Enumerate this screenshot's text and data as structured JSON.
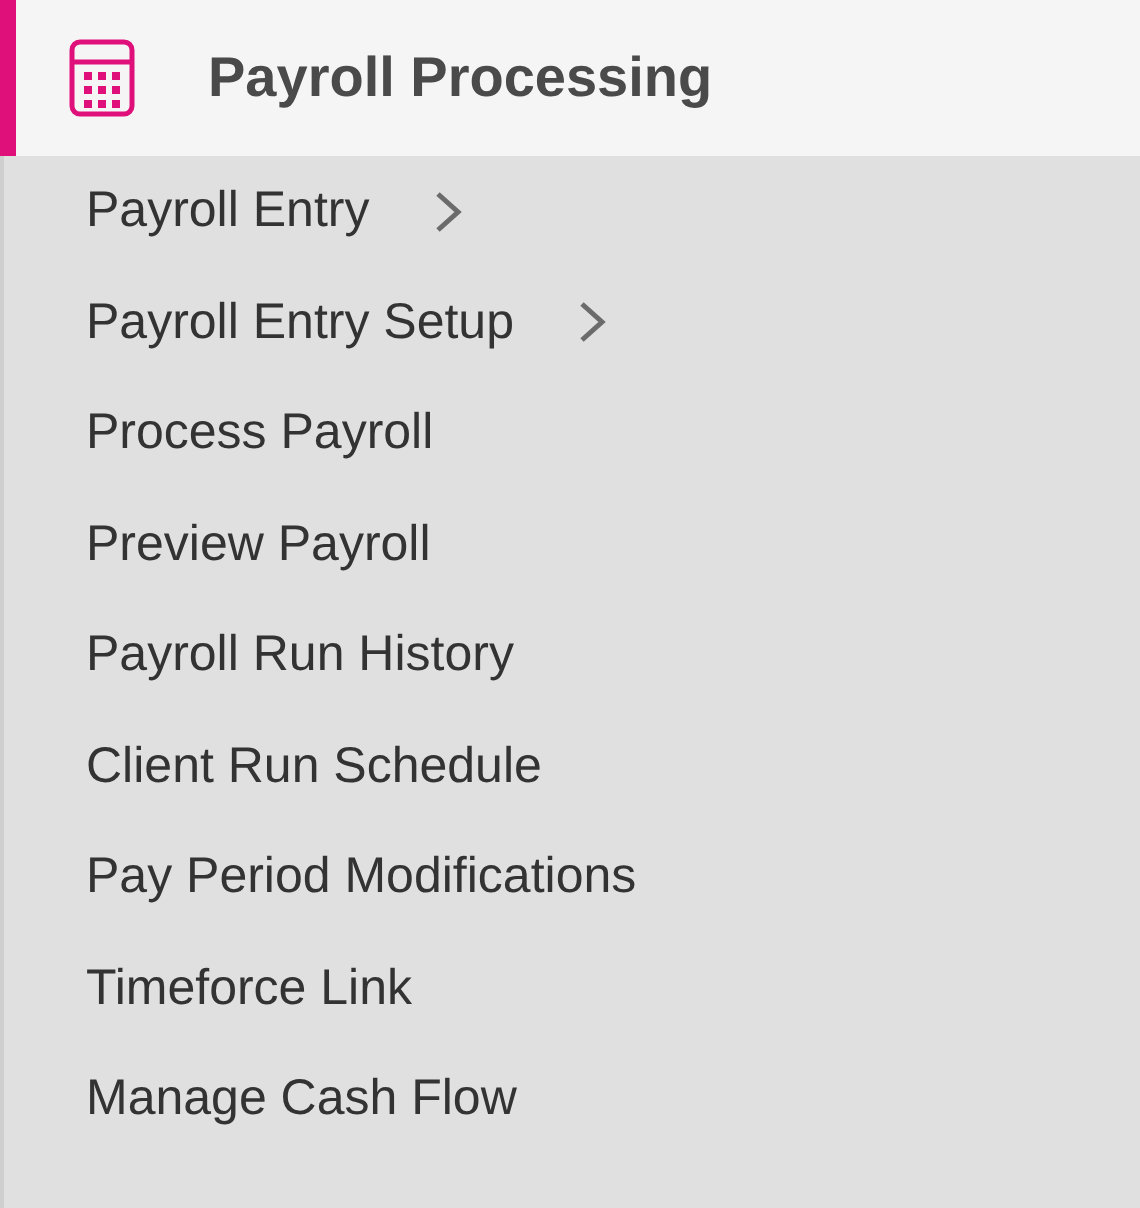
{
  "header": {
    "title": "Payroll Processing",
    "selected": true
  },
  "items": [
    {
      "label": "Payroll Entry",
      "has_submenu": true
    },
    {
      "label": "Payroll Entry Setup",
      "has_submenu": true
    },
    {
      "label": "Process Payroll",
      "has_submenu": false
    },
    {
      "label": "Preview Payroll",
      "has_submenu": false
    },
    {
      "label": "Payroll Run History",
      "has_submenu": false
    },
    {
      "label": "Client Run Schedule",
      "has_submenu": false
    },
    {
      "label": "Pay Period Modifications",
      "has_submenu": false
    },
    {
      "label": "Timeforce Link",
      "has_submenu": false
    },
    {
      "label": "Manage Cash Flow",
      "has_submenu": false
    }
  ]
}
